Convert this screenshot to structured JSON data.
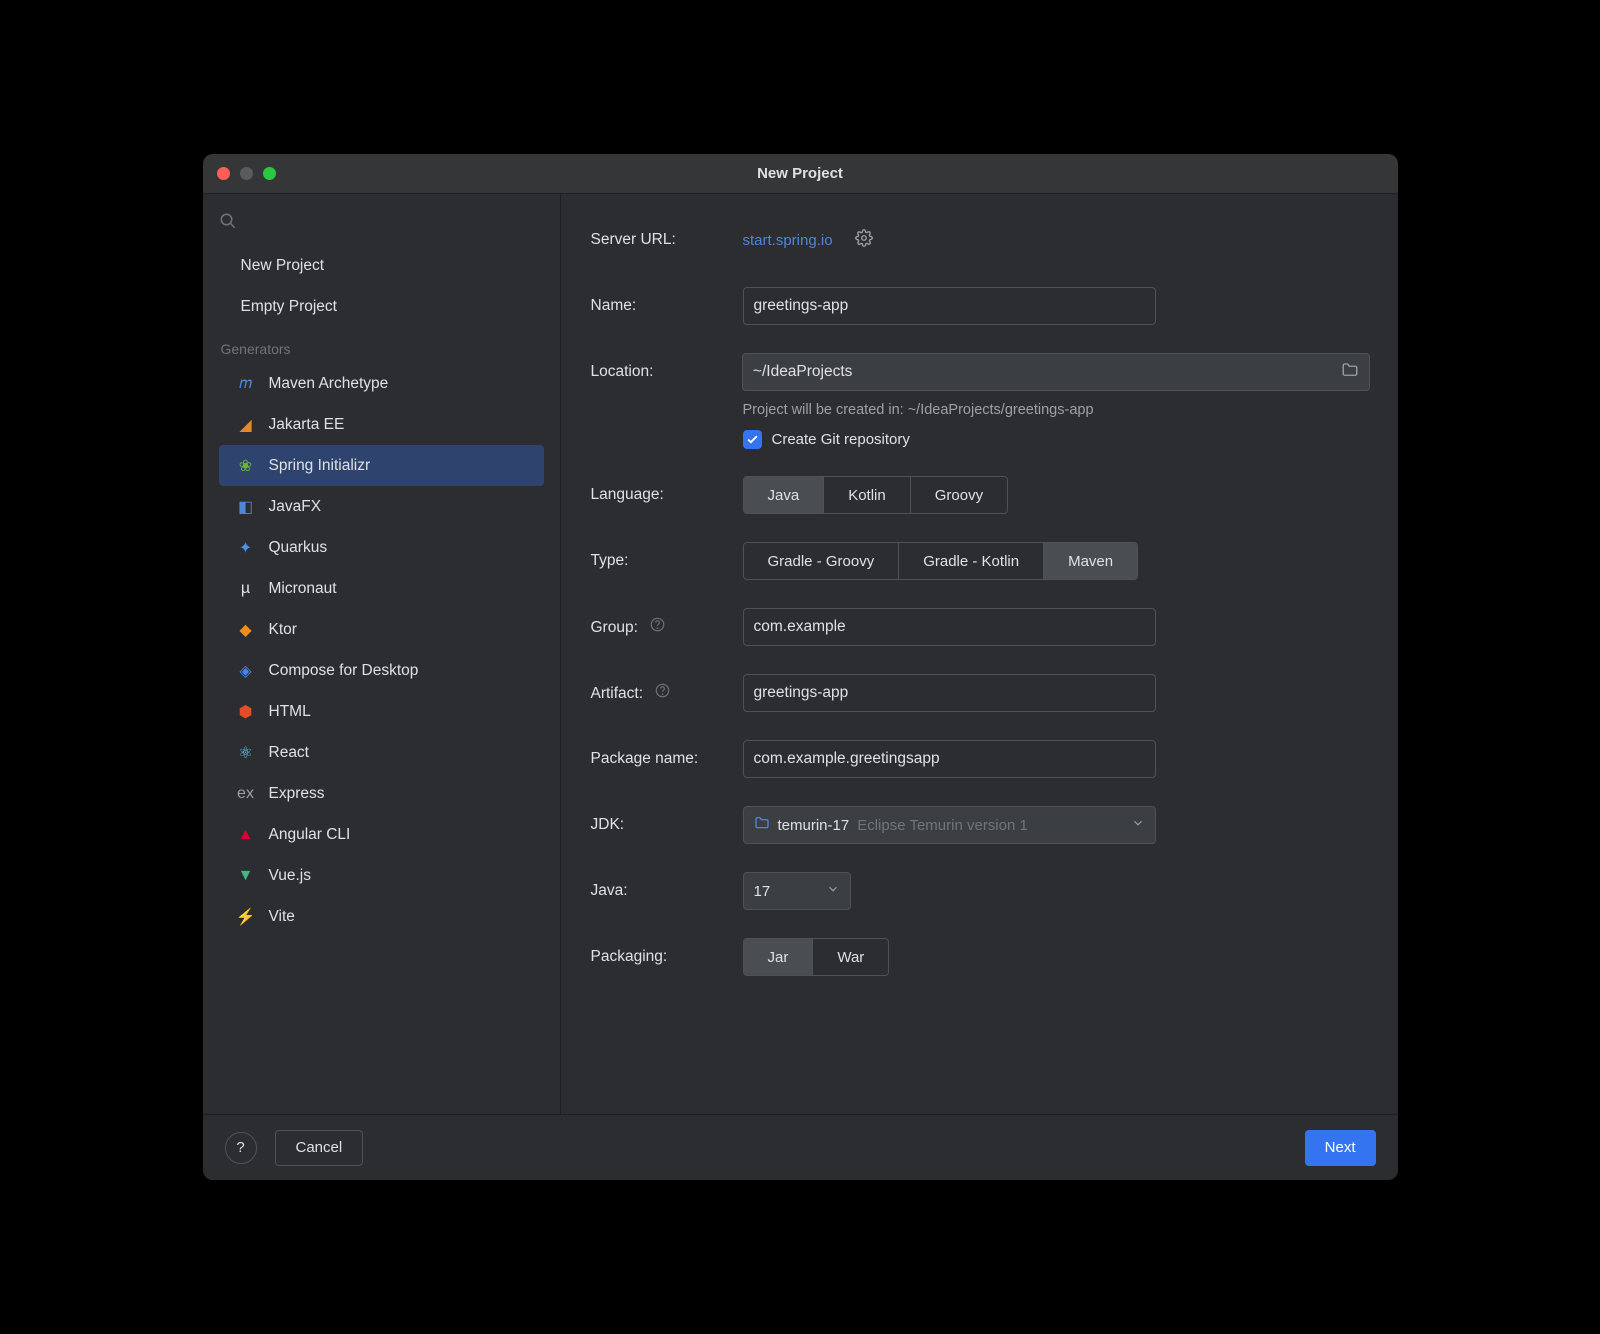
{
  "window": {
    "title": "New Project"
  },
  "sidebar": {
    "top_items": [
      {
        "label": "New Project"
      },
      {
        "label": "Empty Project"
      }
    ],
    "section_label": "Generators",
    "generators": [
      {
        "label": "Maven Archetype",
        "icon": "maven-icon",
        "glyph": "𝑚",
        "color": "#5086d8"
      },
      {
        "label": "Jakarta EE",
        "icon": "jakarta-icon",
        "glyph": "◢",
        "color": "#e28a2b"
      },
      {
        "label": "Spring Initializr",
        "icon": "spring-icon",
        "glyph": "❀",
        "color": "#6db33f",
        "selected": true
      },
      {
        "label": "JavaFX",
        "icon": "javafx-icon",
        "glyph": "◧",
        "color": "#5086d8"
      },
      {
        "label": "Quarkus",
        "icon": "quarkus-icon",
        "glyph": "✦",
        "color": "#4695eb"
      },
      {
        "label": "Micronaut",
        "icon": "micronaut-icon",
        "glyph": "µ",
        "color": "#dfe1e5"
      },
      {
        "label": "Ktor",
        "icon": "ktor-icon",
        "glyph": "◆",
        "color": "#f28c1c"
      },
      {
        "label": "Compose for Desktop",
        "icon": "compose-icon",
        "glyph": "◈",
        "color": "#4285f4"
      },
      {
        "label": "HTML",
        "icon": "html-icon",
        "glyph": "⬢",
        "color": "#e44d26"
      },
      {
        "label": "React",
        "icon": "react-icon",
        "glyph": "⚛",
        "color": "#61dafb"
      },
      {
        "label": "Express",
        "icon": "express-icon",
        "glyph": "ex",
        "color": "#9da0a8"
      },
      {
        "label": "Angular CLI",
        "icon": "angular-icon",
        "glyph": "▲",
        "color": "#dd0031"
      },
      {
        "label": "Vue.js",
        "icon": "vue-icon",
        "glyph": "▼",
        "color": "#41b883"
      },
      {
        "label": "Vite",
        "icon": "vite-icon",
        "glyph": "⚡",
        "color": "#a452e8"
      }
    ]
  },
  "form": {
    "server_url_label": "Server URL:",
    "server_url": "start.spring.io",
    "name_label": "Name:",
    "name_value": "greetings-app",
    "location_label": "Location:",
    "location_value": "~/IdeaProjects",
    "hint": "Project will be created in: ~/IdeaProjects/greetings-app",
    "create_git_label": "Create Git repository",
    "language_label": "Language:",
    "languages": [
      {
        "label": "Java",
        "selected": true
      },
      {
        "label": "Kotlin"
      },
      {
        "label": "Groovy"
      }
    ],
    "type_label": "Type:",
    "types": [
      {
        "label": "Gradle - Groovy"
      },
      {
        "label": "Gradle - Kotlin"
      },
      {
        "label": "Maven",
        "selected": true
      }
    ],
    "group_label": "Group:",
    "group_value": "com.example",
    "artifact_label": "Artifact:",
    "artifact_value": "greetings-app",
    "package_label": "Package name:",
    "package_value": "com.example.greetingsapp",
    "jdk_label": "JDK:",
    "jdk_main": "temurin-17",
    "jdk_dim": "Eclipse Temurin version 1",
    "java_label": "Java:",
    "java_value": "17",
    "packaging_label": "Packaging:",
    "packagings": [
      {
        "label": "Jar",
        "selected": true
      },
      {
        "label": "War"
      }
    ]
  },
  "footer": {
    "cancel": "Cancel",
    "next": "Next"
  }
}
